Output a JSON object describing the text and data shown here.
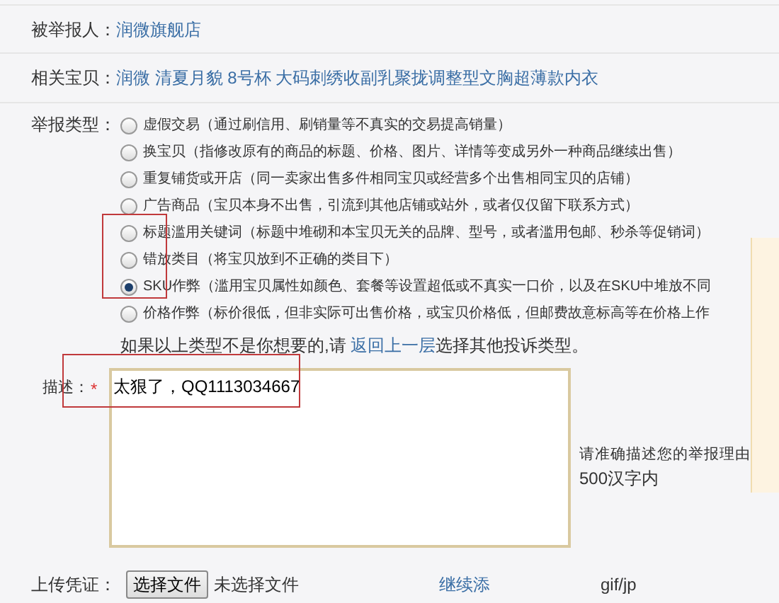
{
  "reported": {
    "label": "被举报人：",
    "value": "润微旗舰店"
  },
  "item": {
    "label": "相关宝贝：",
    "value": "润微 清夏月貌 8号杯 大码刺绣收副乳聚拢调整型文胸超薄款内衣"
  },
  "report_type": {
    "label": "举报类型：",
    "options": [
      {
        "text": "虚假交易（通过刷信用、刷销量等不真实的交易提高销量）",
        "selected": false
      },
      {
        "text": "换宝贝（指修改原有的商品的标题、价格、图片、详情等变成另外一种商品继续出售）",
        "selected": false
      },
      {
        "text": "重复铺货或开店（同一卖家出售多件相同宝贝或经营多个出售相同宝贝的店铺）",
        "selected": false
      },
      {
        "text": "广告商品（宝贝本身不出售，引流到其他店铺或站外，或者仅仅留下联系方式）",
        "selected": false
      },
      {
        "text": "标题滥用关键词（标题中堆砌和本宝贝无关的品牌、型号，或者滥用包邮、秒杀等促销词）",
        "selected": false
      },
      {
        "text": "错放类目（将宝贝放到不正确的类目下）",
        "selected": false
      },
      {
        "text": "SKU作弊（滥用宝贝属性如颜色、套餐等设置超低或不真实一口价，以及在SKU中堆放不同",
        "selected": true
      },
      {
        "text": "价格作弊（标价很低，但非实际可出售价格，或宝贝价格低，但邮费故意标高等在价格上作",
        "selected": false
      }
    ],
    "note_before": "如果以上类型不是你想要的,请 ",
    "note_link": "返回上一层",
    "note_after": "选择其他投诉类型。"
  },
  "description": {
    "label": "描述：",
    "required_mark": "*",
    "value": "太狠了，QQ1113034667",
    "hint": "请准确描述您的举报理由",
    "limit": "500汉字内"
  },
  "upload": {
    "label": "上传凭证：",
    "button": "选择文件",
    "status": "未选择文件",
    "add_link": "继续添",
    "formats": "gif/jp"
  }
}
